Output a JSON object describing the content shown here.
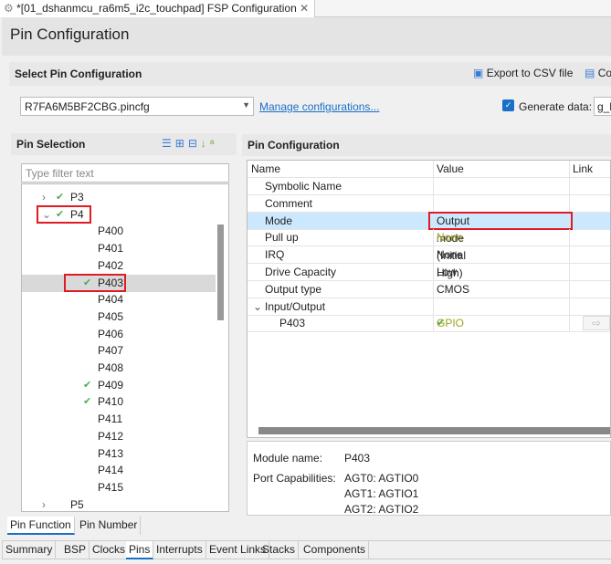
{
  "editor_tab": {
    "title": "*[01_dshanmcu_ra6m5_i2c_touchpad] FSP Configuration"
  },
  "header": {
    "title": "Pin Configuration"
  },
  "select_section": {
    "title": "Select Pin Configuration",
    "export_label": "Export to CSV file",
    "config_label": "Co",
    "file": "R7FA6M5BF2CBG.pincfg",
    "manage_link": "Manage configurations...",
    "generate_label": "Generate data:",
    "generate_checked": true,
    "generate_value": "g_b"
  },
  "pin_selection": {
    "title": "Pin Selection",
    "filter_placeholder": "Type filter text",
    "items": [
      {
        "label": "P3",
        "level": 0,
        "checked": true,
        "expander": "collapsed"
      },
      {
        "label": "P4",
        "level": 0,
        "checked": true,
        "expander": "expanded",
        "highlighted": true
      },
      {
        "label": "P400",
        "level": 1
      },
      {
        "label": "P401",
        "level": 1
      },
      {
        "label": "P402",
        "level": 1
      },
      {
        "label": "P403",
        "level": 1,
        "checked": true,
        "selected": true,
        "highlighted": true
      },
      {
        "label": "P404",
        "level": 1
      },
      {
        "label": "P405",
        "level": 1
      },
      {
        "label": "P406",
        "level": 1
      },
      {
        "label": "P407",
        "level": 1
      },
      {
        "label": "P408",
        "level": 1
      },
      {
        "label": "P409",
        "level": 1,
        "checked": true
      },
      {
        "label": "P410",
        "level": 1,
        "checked": true
      },
      {
        "label": "P411",
        "level": 1
      },
      {
        "label": "P412",
        "level": 1
      },
      {
        "label": "P413",
        "level": 1
      },
      {
        "label": "P414",
        "level": 1
      },
      {
        "label": "P415",
        "level": 1
      },
      {
        "label": "P5",
        "level": 0,
        "expander": "collapsed"
      }
    ]
  },
  "pin_config": {
    "title": "Pin Configuration",
    "columns": [
      "Name",
      "Value",
      "Link"
    ],
    "rows": [
      {
        "name": "Symbolic Name",
        "value": ""
      },
      {
        "name": "Comment",
        "value": ""
      },
      {
        "name": "Mode",
        "value": "Output mode (Initial High)",
        "selected": true
      },
      {
        "name": "Pull up",
        "value": "None",
        "dim": true
      },
      {
        "name": "IRQ",
        "value": "None"
      },
      {
        "name": "Drive Capacity",
        "value": "Low"
      },
      {
        "name": "Output type",
        "value": "CMOS"
      },
      {
        "name": "Input/Output",
        "value": "",
        "group": true
      },
      {
        "name": "P403",
        "value": "GPIO",
        "dim": true,
        "checked": true,
        "link": true,
        "indent": 2
      }
    ]
  },
  "module_info": {
    "module_label": "Module name:",
    "module_value": "P403",
    "caps_label": "Port Capabilities:",
    "caps": [
      "AGT0: AGTIO0",
      "AGT1: AGTIO1",
      "AGT2: AGTIO2"
    ]
  },
  "view_tabs": [
    "Pin Function",
    "Pin Number"
  ],
  "bottom_tabs": [
    "Summary",
    "BSP",
    "Clocks",
    "Pins",
    "Interrupts",
    "Event Links",
    "Stacks",
    "Components"
  ],
  "active_bottom_tab": "Pins",
  "colors": {
    "highlight": "#e01b24",
    "selection": "#cce8ff",
    "check": "#4caf50",
    "dim_value": "#a0a020"
  }
}
